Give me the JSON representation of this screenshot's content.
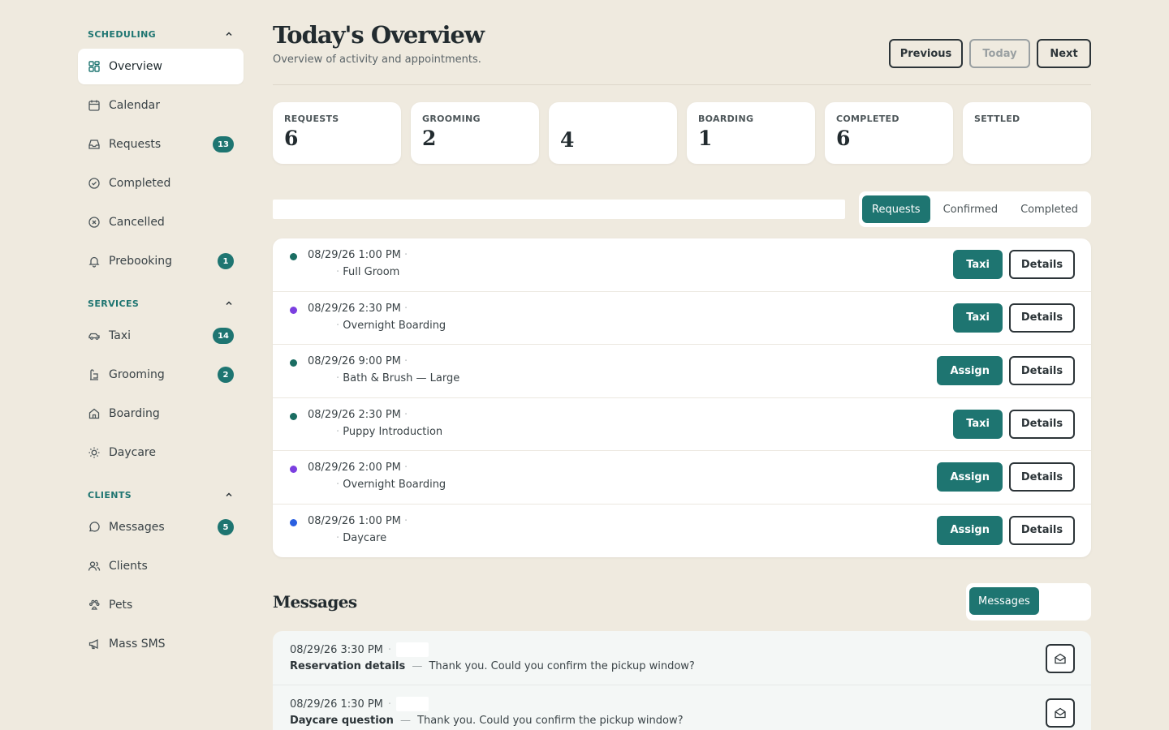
{
  "sidebar": {
    "sections": [
      {
        "title": "SCHEDULING",
        "items": [
          {
            "label": "Overview",
            "icon": "grid-icon",
            "active": true
          },
          {
            "label": "Calendar",
            "icon": "calendar-icon"
          },
          {
            "label": "Requests",
            "icon": "inbox-icon",
            "badge": "13"
          },
          {
            "label": "Completed",
            "icon": "check-circle-icon"
          },
          {
            "label": "Cancelled",
            "icon": "x-circle-icon"
          },
          {
            "label": "Prebooking",
            "icon": "bell-icon",
            "badge": "1"
          }
        ]
      },
      {
        "title": "SERVICES",
        "items": [
          {
            "label": "Taxi",
            "icon": "car-icon",
            "badge": "14"
          },
          {
            "label": "Grooming",
            "icon": "bath-icon",
            "badge": "2"
          },
          {
            "label": "Boarding",
            "icon": "home-icon"
          },
          {
            "label": "Daycare",
            "icon": "sun-icon"
          }
        ]
      },
      {
        "title": "CLIENTS",
        "items": [
          {
            "label": "Messages",
            "icon": "message-icon",
            "badge": "5"
          },
          {
            "label": "Clients",
            "icon": "users-icon"
          },
          {
            "label": "Pets",
            "icon": "paw-icon"
          },
          {
            "label": "Mass SMS",
            "icon": "megaphone-icon"
          }
        ]
      }
    ]
  },
  "header": {
    "title": "Today's Overview",
    "subtitle": "Overview of activity and appointments.",
    "previous_label": "Previous",
    "today_label": "Today",
    "next_label": "Next"
  },
  "stats": [
    {
      "label": "REQUESTS",
      "value": "6"
    },
    {
      "label": "GROOMING",
      "value": "2"
    },
    {
      "label": "",
      "value": "4"
    },
    {
      "label": "BOARDING",
      "value": "1"
    },
    {
      "label": "COMPLETED",
      "value": "6"
    },
    {
      "label": "SETTLED",
      "value": ""
    }
  ],
  "appointment_tabs": {
    "items": [
      "Requests",
      "Confirmed",
      "Completed"
    ],
    "active": "Requests"
  },
  "appointments": [
    {
      "time": "08/29/26 1:00 PM",
      "service": "Full Groom",
      "dot_color": "#1a6d62",
      "action": "Taxi",
      "details_label": "Details"
    },
    {
      "time": "08/29/26 2:30 PM",
      "service": "Overnight Boarding",
      "dot_color": "#7b3fe0",
      "action": "Taxi",
      "details_label": "Details"
    },
    {
      "time": "08/29/26 9:00 PM",
      "service": "Bath & Brush — Large",
      "dot_color": "#1a6d62",
      "action": "Assign",
      "details_label": "Details"
    },
    {
      "time": "08/29/26 2:30 PM",
      "service": "Puppy Introduction",
      "dot_color": "#1a6d62",
      "action": "Taxi",
      "details_label": "Details"
    },
    {
      "time": "08/29/26 2:00 PM",
      "service": "Overnight Boarding",
      "dot_color": "#7b3fe0",
      "action": "Assign",
      "details_label": "Details"
    },
    {
      "time": "08/29/26 1:00 PM",
      "service": "Daycare",
      "dot_color": "#2a5fe0",
      "action": "Assign",
      "details_label": "Details"
    }
  ],
  "messages_section": {
    "title": "Messages",
    "tab_label": "Messages",
    "items": [
      {
        "time": "08/29/26 3:30 PM",
        "subject": "Reservation details",
        "preview": "Thank you. Could you confirm the pickup window?"
      },
      {
        "time": "08/29/26 1:30 PM",
        "subject": "Daycare question",
        "preview": "Thank you. Could you confirm the pickup window?"
      }
    ]
  },
  "colors": {
    "accent": "#1e7571",
    "background": "#efeadf",
    "text": "#2c3438"
  }
}
